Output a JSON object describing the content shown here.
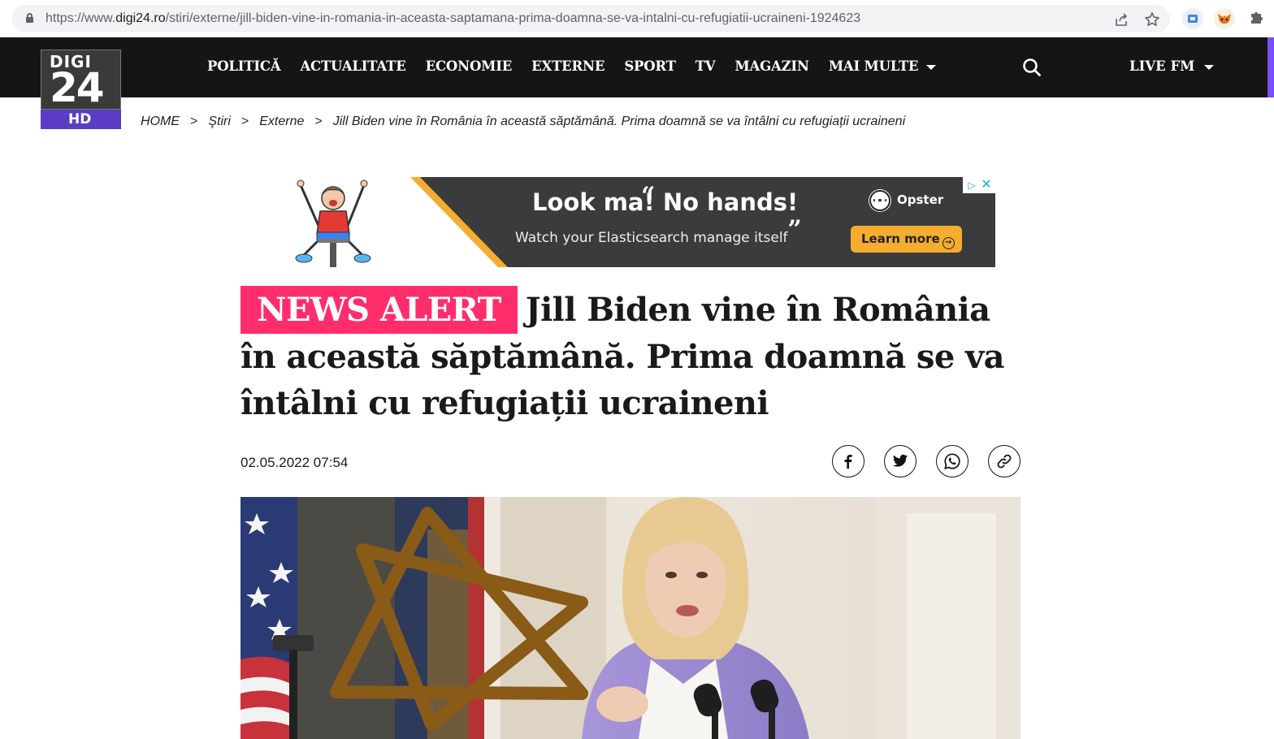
{
  "browser": {
    "url_prefix": "https://www.",
    "url_host": "digi24.ro",
    "url_path": "/stiri/externe/jill-biden-vine-in-romania-in-aceasta-saptamana-prima-doamna-se-va-intalni-cu-refugiatii-ucraineni-1924623",
    "icons": [
      "lock-icon",
      "share-icon",
      "star-icon",
      "extension-icon",
      "metamask-icon",
      "puzzle-icon"
    ]
  },
  "header": {
    "logo": {
      "top": "DIGI",
      "number": "24",
      "bottom": "HD"
    },
    "nav": [
      "POLITICĂ",
      "ACTUALITATE",
      "ECONOMIE",
      "EXTERNE",
      "SPORT",
      "TV",
      "MAGAZIN",
      "MAI MULTE"
    ],
    "live": "LIVE FM",
    "colors": {
      "header_bg": "#151515",
      "accent_purple": "#5b3cc4",
      "alert_pink": "#ff2d6b"
    }
  },
  "breadcrumb": [
    "HOME",
    "Ştiri",
    "Externe",
    "Jill Biden vine în România în această săptămână. Prima doamnă se va întâlni cu refugiații ucraineni"
  ],
  "ad": {
    "headline": "Look ma! No hands!",
    "subline": "Watch your Elasticsearch manage itself",
    "brand": "Opster",
    "cta": "Learn more"
  },
  "article": {
    "badge": "NEWS ALERT",
    "title": "Jill Biden vine în România în această săptămână. Prima doamnă se va întâlni cu refugiații ucraineni",
    "datetime": "02.05.2022 07:54",
    "share": [
      "facebook-icon",
      "twitter-icon",
      "whatsapp-icon",
      "link-icon"
    ]
  }
}
